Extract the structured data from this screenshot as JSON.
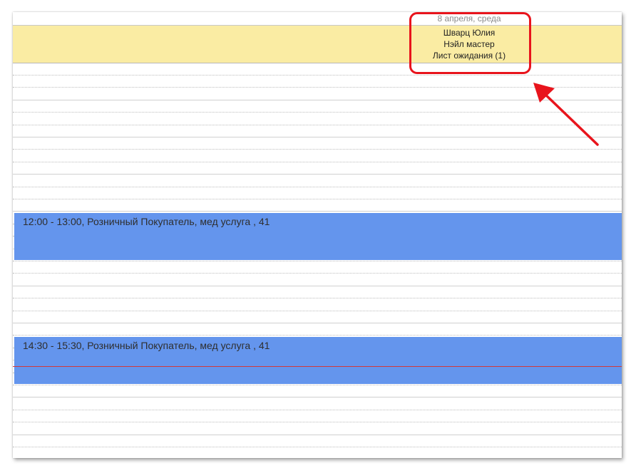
{
  "calendar": {
    "date_label": "8 апреля, среда",
    "staff": {
      "name": "Шварц Юлия",
      "role": "Нэйл мастер",
      "waitlist": "Лист ожидания (1)"
    }
  },
  "events": [
    {
      "label": "12:00 - 13:00, Розничный Покупатель, мед услуга , 41"
    },
    {
      "label": "14:30 - 15:30, Розничный Покупатель, мед услуга , 41"
    }
  ],
  "colors": {
    "event_bg": "#6495ed",
    "header_bg": "#faeca3",
    "annotation": "#e8141c",
    "current_time_line": "#d23a3a"
  }
}
